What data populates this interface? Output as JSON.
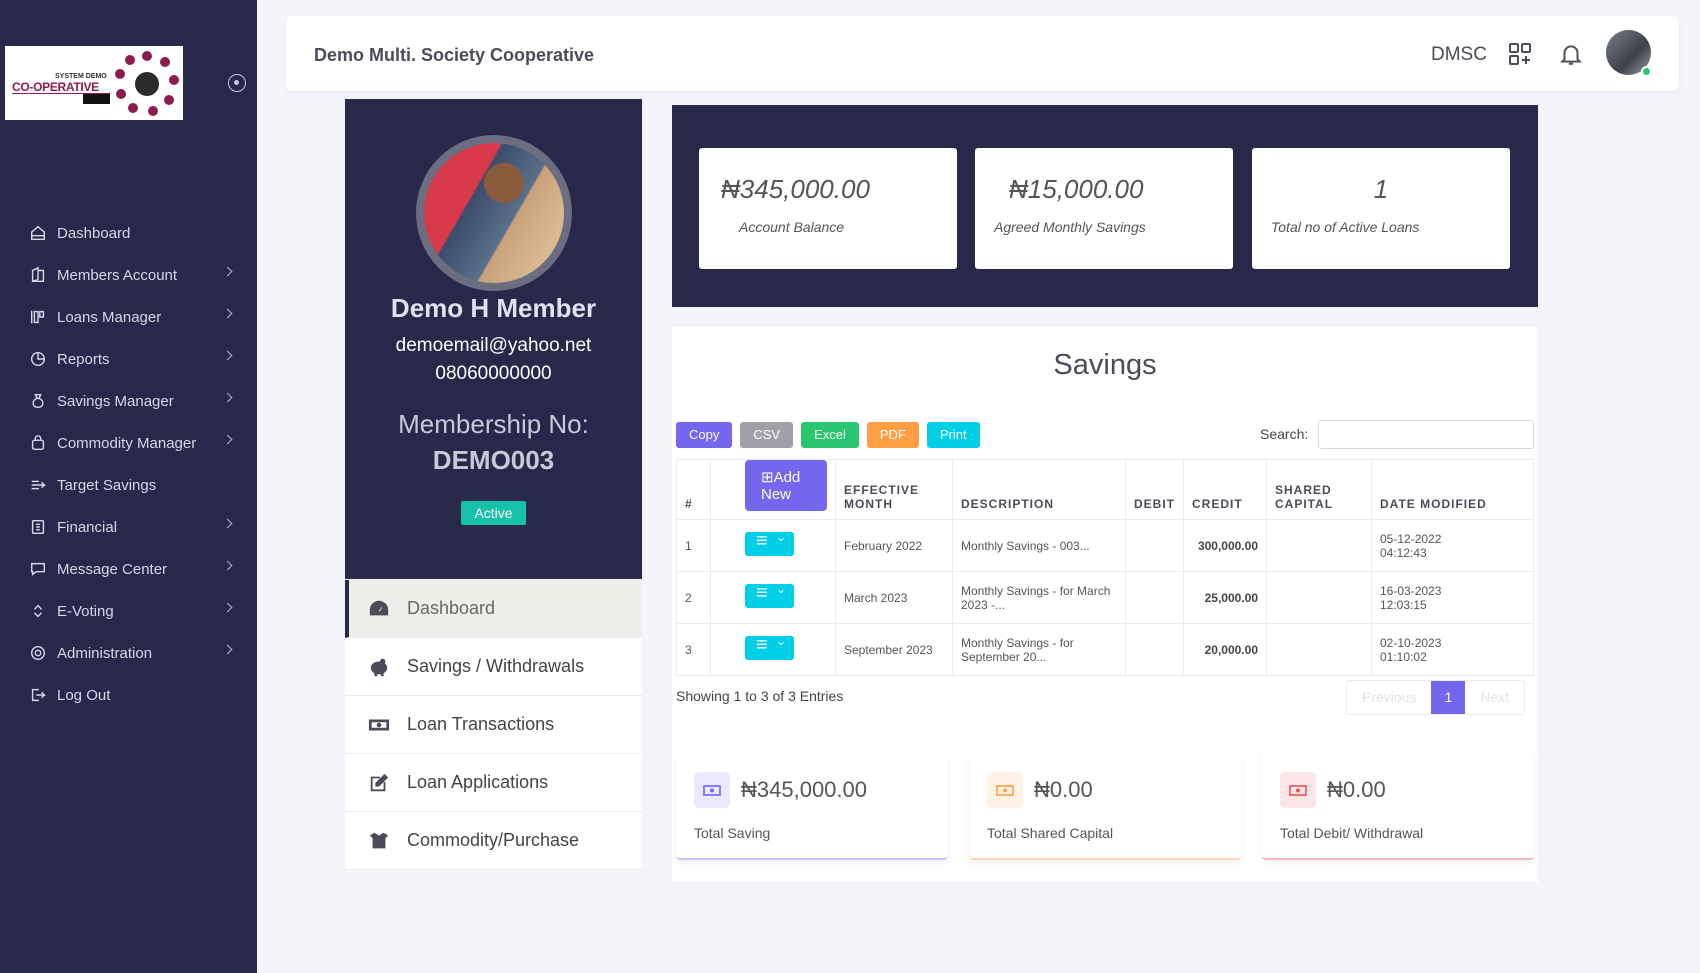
{
  "logo": {
    "small_text": "SYSTEM DEMO",
    "text": "CO-OPERATIVE"
  },
  "sidebar": {
    "items": [
      {
        "label": "Dashboard"
      },
      {
        "label": "Members Account"
      },
      {
        "label": "Loans Manager"
      },
      {
        "label": "Reports"
      },
      {
        "label": "Savings Manager"
      },
      {
        "label": "Commodity Manager"
      },
      {
        "label": "Target Savings"
      },
      {
        "label": "Financial"
      },
      {
        "label": "Message Center"
      },
      {
        "label": "E-Voting"
      },
      {
        "label": "Administration"
      },
      {
        "label": "Log Out"
      }
    ]
  },
  "topbar": {
    "org_name": "Demo Multi. Society Cooperative",
    "org_code": "DMSC"
  },
  "profile": {
    "name": "Demo H Member",
    "email": "demoemail@yahoo.net",
    "phone": "08060000000",
    "membership_label": "Membership No:",
    "membership_no": "DEMO003",
    "status": "Active"
  },
  "profile_menu": [
    {
      "label": "Dashboard",
      "icon": "dashboard-icon"
    },
    {
      "label": "Savings / Withdrawals",
      "icon": "piggy-bank-icon"
    },
    {
      "label": "Loan Transactions",
      "icon": "money-bill-icon"
    },
    {
      "label": "Loan Applications",
      "icon": "edit-icon"
    },
    {
      "label": "Commodity/Purchase",
      "icon": "box-open-icon"
    }
  ],
  "stats": [
    {
      "value": "₦345,000.00",
      "label": "Account Balance"
    },
    {
      "value": "₦15,000.00",
      "label": "Agreed Monthly Savings"
    },
    {
      "value": "1",
      "label": "Total no of Active Loans"
    }
  ],
  "savings": {
    "title": "Savings",
    "buttons": [
      {
        "label": "Copy",
        "color": "#7367f0"
      },
      {
        "label": "CSV",
        "color": "#a0a0a8"
      },
      {
        "label": "Excel",
        "color": "#28c76f"
      },
      {
        "label": "PDF",
        "color": "#ff9f43"
      },
      {
        "label": "Print",
        "color": "#00cfe8"
      }
    ],
    "search_label": "Search:",
    "add_new": "Add New",
    "columns": [
      "#",
      "",
      "EFFECTIVE MONTH",
      "DESCRIPTION",
      "DEBIT",
      "CREDIT",
      "SHARED CAPITAL",
      "DATE MODIFIED"
    ],
    "rows": [
      {
        "no": "1",
        "month": "February 2022",
        "description": "Monthly Savings - 003...",
        "debit": "",
        "credit": "300,000.00",
        "shared": "",
        "date": "05-12-2022",
        "time": "04:12:43"
      },
      {
        "no": "2",
        "month": "March 2023",
        "description": "Monthly Savings - for March 2023 -...",
        "debit": "",
        "credit": "25,000.00",
        "shared": "",
        "date": "16-03-2023",
        "time": "12:03:15"
      },
      {
        "no": "3",
        "month": "September 2023",
        "description": "Monthly Savings - for September 20...",
        "debit": "",
        "credit": "20,000.00",
        "shared": "",
        "date": "02-10-2023",
        "time": "01:10:02"
      }
    ],
    "showing": "Showing 1 to 3 of 3 Entries",
    "pager": {
      "prev": "Previous",
      "current": "1",
      "next": "Next"
    }
  },
  "summary": [
    {
      "value": "₦345,000.00",
      "label": "Total Saving",
      "color": "#7367f0",
      "bg": "#ebe9fd"
    },
    {
      "value": "₦0.00",
      "label": "Total Shared Capital",
      "color": "#ff9f43",
      "bg": "#fff1e3"
    },
    {
      "value": "₦0.00",
      "label": "Total Debit/ Withdrawal",
      "color": "#ea5455",
      "bg": "#fce5e6"
    }
  ]
}
